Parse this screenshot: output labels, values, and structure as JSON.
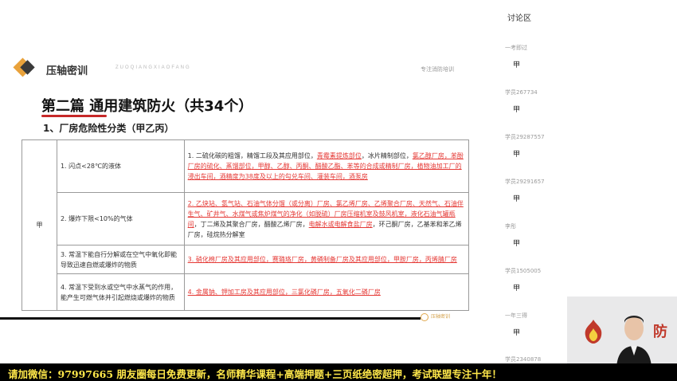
{
  "slide": {
    "brand": "压轴密训",
    "brand_sub": "ZUOQIANGXIAOFANG",
    "top_note": "专注消防培训",
    "title": "第二篇 通用建筑防火（共34个）",
    "subtitle": "1、厂房危险性分类（甲乙丙）",
    "watermark": "压轴密训",
    "table": {
      "grade": "甲",
      "rows": [
        {
          "condition": "1. 闪点<28℃的液体",
          "examples": [
            {
              "t": "1. 二硫化碳的粗馏，精馏工段及其应用部位，",
              "red": false
            },
            {
              "t": "青霉素提炼部位",
              "red": true
            },
            {
              "t": "，冰片精制部位，",
              "red": false
            },
            {
              "t": "氯乙醇厂房，苯酚厂房的硫化、蒸馏部位",
              "red": true
            },
            {
              "t": "，甲醇、乙醇、丙酮、醋酸乙酯、苯等的合成或精制厂房，植物油加工厂的浸出车间，酒精度为38度及以上的勾兑车间、灌装车间，酒泵房",
              "red": true
            }
          ]
        },
        {
          "condition": "2. 爆炸下限<10%的气体",
          "examples": [
            {
              "t": "2. 乙炔站、氢气站、石油气体分馏（或分离）厂房、氯乙烯厂房、乙烯聚合厂房、天然气、石油伴生气、矿井气、水煤气或焦炉煤气的净化（如脱硫）厂房压缩机室及鼓风机室，液化石油气罐瓶间",
              "red": true
            },
            {
              "t": "，丁二烯及其聚合厂房，醋酸乙烯厂房，",
              "red": false
            },
            {
              "t": "电解水或电解食盐厂房",
              "red": true
            },
            {
              "t": "，环己酮厂房，乙基苯和苯乙烯厂房，硅烷热分解室",
              "red": false
            }
          ]
        },
        {
          "condition": "3. 常温下能自行分解或在空气中氧化即能导致迅速自燃或爆炸的物质",
          "examples": [
            {
              "t": "3. 硝化棉厂房及其应用部位，赛璐珞厂房，黄磷制备厂房及其应用部位，甲胺厂房，丙烯腈厂房",
              "red": true
            }
          ]
        },
        {
          "condition": "4. 常温下受到水或空气中水蒸气的作用，能产生可燃气体并引起燃烧或爆炸的物质",
          "examples": [
            {
              "t": "4. 金属钠、钾加工房及其应用部位，三氯化磷厂房，五氧化二磷厂房",
              "red": true
            }
          ]
        }
      ]
    }
  },
  "discussion": {
    "title": "讨论区",
    "messages": [
      {
        "user": "一考即过",
        "text": "甲"
      },
      {
        "user": "学员267734",
        "text": "甲"
      },
      {
        "user": "学员29287557",
        "text": "甲"
      },
      {
        "user": "学员29291657",
        "text": "甲"
      },
      {
        "user": "李彤",
        "text": "甲"
      },
      {
        "user": "学员1505005",
        "text": "甲"
      },
      {
        "user": "一年三得",
        "text": "甲"
      },
      {
        "user": "学员2340878",
        "text": ""
      }
    ]
  },
  "webcam": {
    "brand_text": "防"
  },
  "banner": "请加微信：97997665 朋友圈每日免费更新，名师精华课程+高端押题+三页纸绝密超押，考试联盟专注十年！"
}
